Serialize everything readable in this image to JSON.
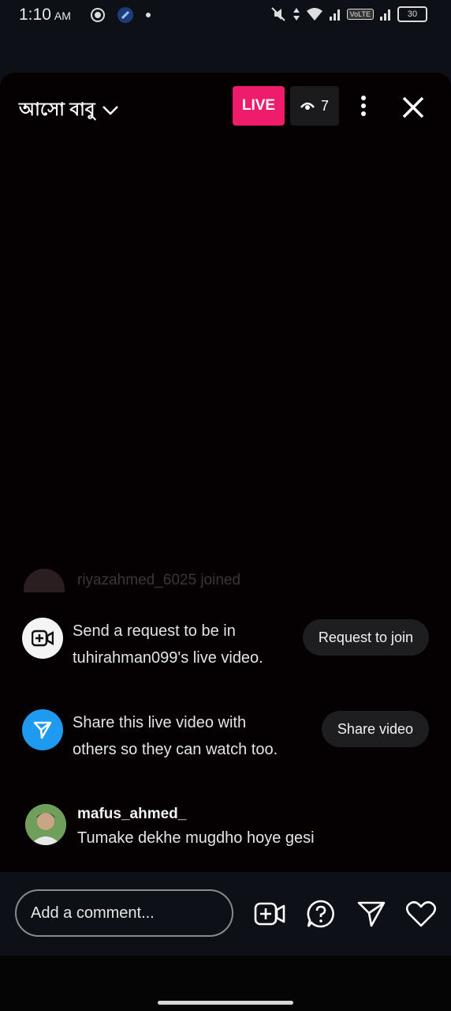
{
  "status_bar": {
    "time": "1:10",
    "ampm": "AM",
    "volte": "VoLTE",
    "battery": "30"
  },
  "live": {
    "title": "আসো বাবু",
    "live_badge": "LIVE",
    "viewer_count": "7"
  },
  "feed": {
    "joined_text": "riyazahmed_6025 joined",
    "request": {
      "text": "Send a request to be in tuhirahman099's live video.",
      "button": "Request to join"
    },
    "share": {
      "text": "Share this live video with others so they can watch too.",
      "button": "Share video"
    },
    "comment": {
      "username": "mafus_ahmed_",
      "message": "Tumake dekhe mugdho hoye gesi"
    }
  },
  "bottom_bar": {
    "comment_placeholder": "Add a comment..."
  },
  "icons": [
    "wifi-icon",
    "signal-icon",
    "battery-icon",
    "chevron-down-icon",
    "eye-icon",
    "more-icon",
    "close-icon",
    "video-add-icon",
    "send-icon",
    "question-icon",
    "heart-icon"
  ],
  "colors": {
    "live_badge": "#ef1b6b",
    "share_icon_bg": "#1e9af0",
    "background": "#050102"
  }
}
